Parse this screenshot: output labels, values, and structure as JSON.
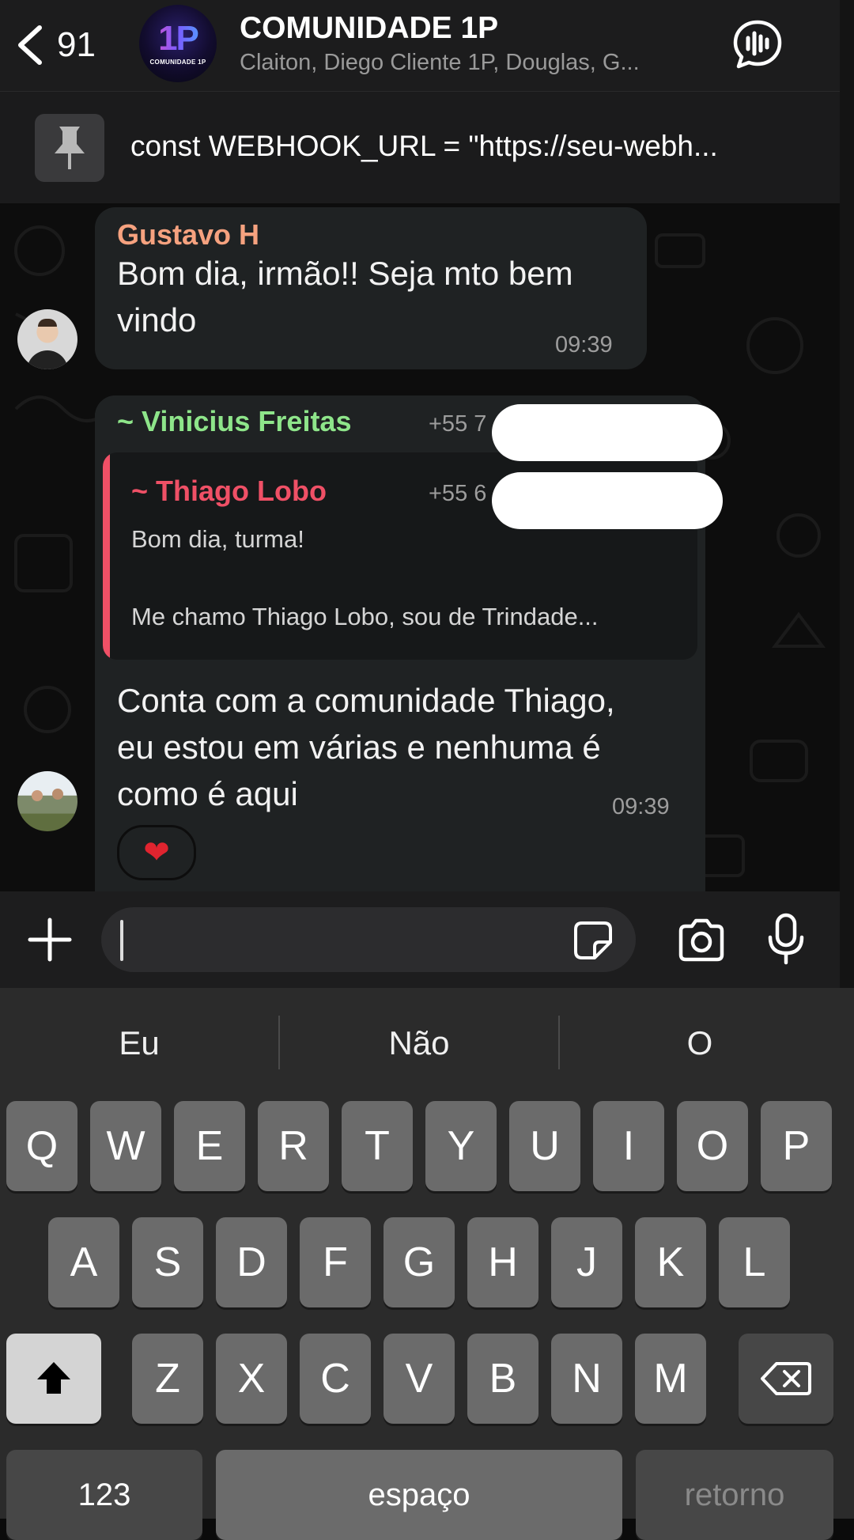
{
  "header": {
    "back_count": "91",
    "avatar_logo": "1P",
    "avatar_caption": "COMUNIDADE 1P",
    "title": "COMUNIDADE 1P",
    "subtitle": "Claiton, Diego Cliente 1P, Douglas, G..."
  },
  "pinned": {
    "text": "const WEBHOOK_URL = \"https://seu-webh..."
  },
  "messages": [
    {
      "sender": "Gustavo H",
      "sender_color": "#f6a27f",
      "line1": "Bom dia, irmão!! Seja mto bem",
      "line2": "vindo",
      "time": "09:39"
    },
    {
      "sender": "~ Vinicius Freitas",
      "sender_color": "#8ee58a",
      "phone": "+55 7",
      "quote": {
        "sender": "~ Thiago Lobo",
        "sender_color": "#ef5066",
        "phone": "+55 6",
        "line1": "Bom dia, turma!",
        "line2": "Me chamo Thiago Lobo, sou de Trindade..."
      },
      "line1": "Conta com a comunidade Thiago,",
      "line2": "eu estou em várias e nenhuma é",
      "line3": "como é aqui",
      "time": "09:39",
      "reaction": "❤"
    }
  ],
  "composer": {
    "icons": [
      "plus-icon",
      "sticker-icon",
      "camera-icon",
      "microphone-icon"
    ]
  },
  "keyboard": {
    "suggestions": [
      "Eu",
      "Não",
      "O"
    ],
    "row1": [
      "Q",
      "W",
      "E",
      "R",
      "T",
      "Y",
      "U",
      "I",
      "O",
      "P"
    ],
    "row2": [
      "A",
      "S",
      "D",
      "F",
      "G",
      "H",
      "J",
      "K",
      "L"
    ],
    "row3": [
      "Z",
      "X",
      "C",
      "V",
      "B",
      "N",
      "M"
    ],
    "numbers_label": "123",
    "space_label": "espaço",
    "return_label": "retorno"
  }
}
